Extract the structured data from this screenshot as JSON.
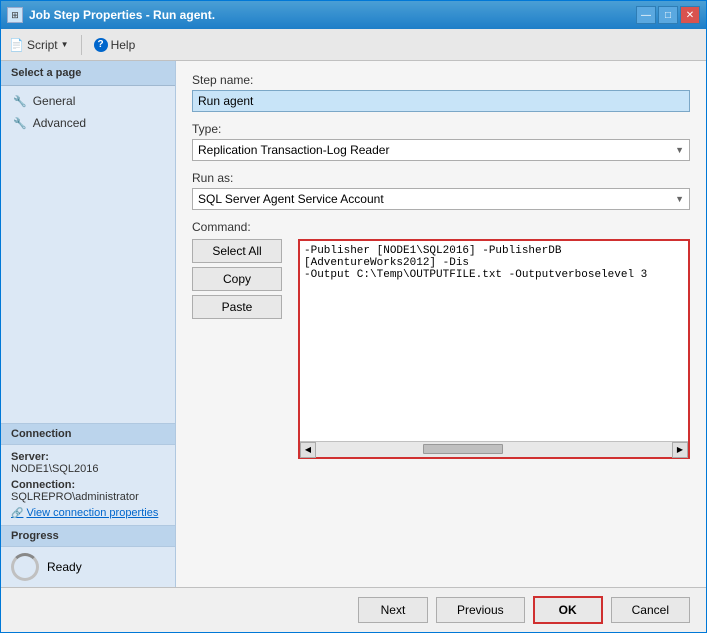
{
  "window": {
    "title": "Job Step Properties - Run agent.",
    "icon": "⊞"
  },
  "title_buttons": {
    "minimize": "—",
    "maximize": "□",
    "close": "✕"
  },
  "toolbar": {
    "script_label": "Script",
    "help_label": "Help"
  },
  "sidebar": {
    "select_page_label": "Select a page",
    "items": [
      {
        "label": "General",
        "icon": "🔧"
      },
      {
        "label": "Advanced",
        "icon": "🔧"
      }
    ],
    "connection": {
      "section_title": "Connection",
      "server_label": "Server:",
      "server_value": "NODE1\\SQL2016",
      "connection_label": "Connection:",
      "connection_value": "SQLREPRO\\administrator",
      "view_link": "View connection properties"
    },
    "progress": {
      "section_title": "Progress",
      "status": "Ready"
    }
  },
  "form": {
    "step_name_label": "Step name:",
    "step_name_value": "Run agent",
    "type_label": "Type:",
    "type_value": "Replication Transaction-Log Reader",
    "run_as_label": "Run as:",
    "run_as_value": "SQL Server Agent Service Account",
    "command_label": "Command:",
    "command_text": "-Publisher [NODE1\\SQL2016] -PublisherDB [AdventureWorks2012] -Dis\r\n-Output C:\\Temp\\OUTPUTFILE.txt -Outputverboselevel 3",
    "buttons": {
      "select_all": "Select All",
      "copy": "Copy",
      "paste": "Paste"
    }
  },
  "footer": {
    "next_label": "Next",
    "previous_label": "Previous",
    "ok_label": "OK",
    "cancel_label": "Cancel"
  }
}
